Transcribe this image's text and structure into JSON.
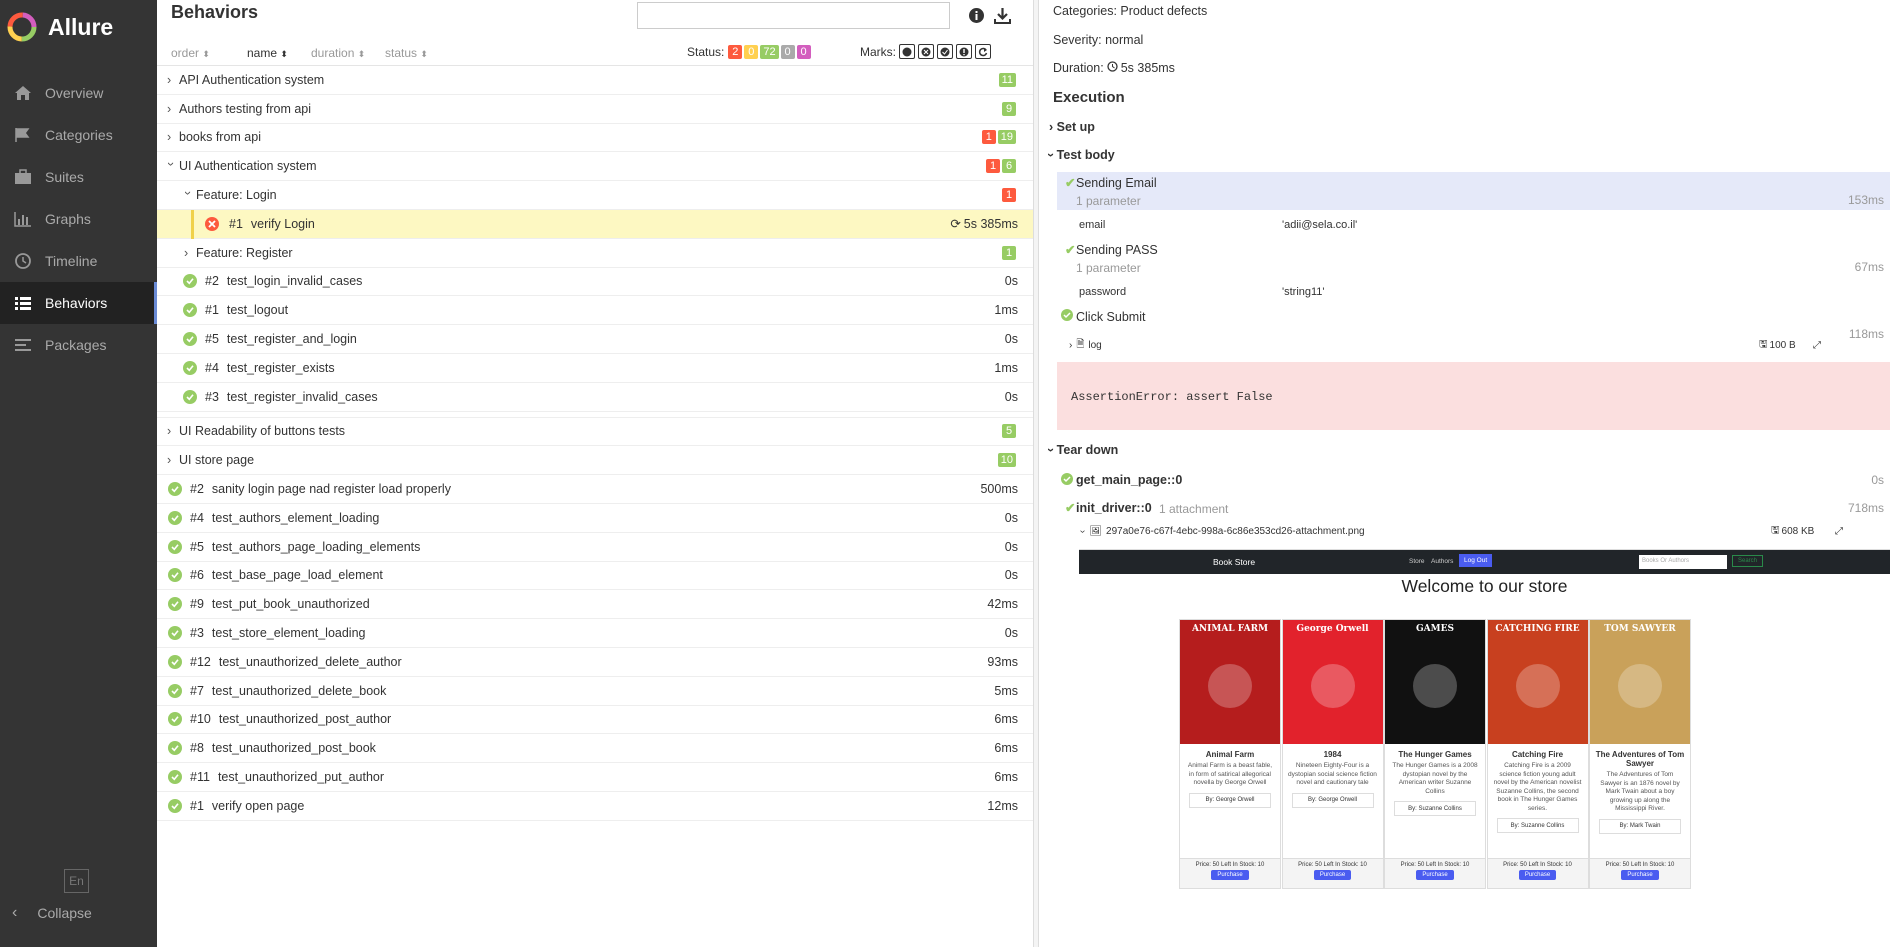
{
  "sidebar": {
    "brand": "Allure",
    "items": [
      {
        "label": "Overview",
        "icon": "home-icon"
      },
      {
        "label": "Categories",
        "icon": "flag-icon"
      },
      {
        "label": "Suites",
        "icon": "briefcase-icon"
      },
      {
        "label": "Graphs",
        "icon": "bar-chart-icon"
      },
      {
        "label": "Timeline",
        "icon": "clock-icon"
      },
      {
        "label": "Behaviors",
        "icon": "list-icon"
      },
      {
        "label": "Packages",
        "icon": "align-left-icon"
      }
    ],
    "active": "Behaviors",
    "lang": "En",
    "collapse": "Collapse"
  },
  "behaviors": {
    "title": "Behaviors",
    "search_placeholder": "",
    "sort": {
      "order": "order",
      "name": "name",
      "duration": "duration",
      "status": "status"
    },
    "status_label": "Status:",
    "status_counts": [
      {
        "value": "2",
        "color": "#fd5a3e"
      },
      {
        "value": "0",
        "color": "#ffd050"
      },
      {
        "value": "72",
        "color": "#97cc64"
      },
      {
        "value": "0",
        "color": "#aaaaaa"
      },
      {
        "value": "0",
        "color": "#d35ebe"
      }
    ],
    "marks_label": "Marks:",
    "groups": [
      {
        "label": "API Authentication system",
        "counts": [
          {
            "v": "11",
            "c": "#97cc64"
          }
        ]
      },
      {
        "label": "Authors testing from api",
        "counts": [
          {
            "v": "9",
            "c": "#97cc64"
          }
        ]
      },
      {
        "label": "books from api",
        "counts": [
          {
            "v": "1",
            "c": "#fd5a3e"
          },
          {
            "v": "19",
            "c": "#97cc64"
          }
        ]
      },
      {
        "label": "UI Authentication system",
        "counts": [
          {
            "v": "1",
            "c": "#fd5a3e"
          },
          {
            "v": "6",
            "c": "#97cc64"
          }
        ]
      }
    ],
    "feature_login": {
      "label": "Feature: Login",
      "count": "1"
    },
    "selected_test": {
      "num": "#1",
      "name": "verify Login",
      "duration": "5s 385ms"
    },
    "feature_register": {
      "label": "Feature: Register",
      "count": "1"
    },
    "auth_tests": [
      {
        "num": "#2",
        "name": "test_login_invalid_cases",
        "dur": "0s"
      },
      {
        "num": "#1",
        "name": "test_logout",
        "dur": "1ms"
      },
      {
        "num": "#5",
        "name": "test_register_and_login",
        "dur": "0s"
      },
      {
        "num": "#4",
        "name": "test_register_exists",
        "dur": "1ms"
      },
      {
        "num": "#3",
        "name": "test_register_invalid_cases",
        "dur": "0s"
      }
    ],
    "groups2": [
      {
        "label": "UI Readability of buttons tests",
        "count": "5"
      },
      {
        "label": "UI store page",
        "count": "10"
      }
    ],
    "root_tests": [
      {
        "num": "#2",
        "name": "sanity login page nad register load properly",
        "dur": "500ms"
      },
      {
        "num": "#4",
        "name": "test_authors_element_loading",
        "dur": "0s"
      },
      {
        "num": "#5",
        "name": "test_authors_page_loading_elements",
        "dur": "0s"
      },
      {
        "num": "#6",
        "name": "test_base_page_load_element",
        "dur": "0s"
      },
      {
        "num": "#9",
        "name": "test_put_book_unauthorized",
        "dur": "42ms"
      },
      {
        "num": "#3",
        "name": "test_store_element_loading",
        "dur": "0s"
      },
      {
        "num": "#12",
        "name": "test_unauthorized_delete_author",
        "dur": "93ms"
      },
      {
        "num": "#7",
        "name": "test_unauthorized_delete_book",
        "dur": "5ms"
      },
      {
        "num": "#10",
        "name": "test_unauthorized_post_author",
        "dur": "6ms"
      },
      {
        "num": "#8",
        "name": "test_unauthorized_post_book",
        "dur": "6ms"
      },
      {
        "num": "#11",
        "name": "test_unauthorized_put_author",
        "dur": "6ms"
      },
      {
        "num": "#1",
        "name": "verify open page",
        "dur": "12ms"
      }
    ]
  },
  "detail": {
    "categories": "Categories: Product defects",
    "severity": "Severity: normal",
    "duration_label": "Duration:",
    "duration": "5s 385ms",
    "execution": "Execution",
    "setup": "Set up",
    "test_body": "Test body",
    "step1": {
      "name": "Sending Email",
      "params": "1 parameter",
      "dur": "153ms",
      "pname": "email",
      "pval": "'adii@sela.co.il'"
    },
    "step2": {
      "name": "Sending PASS",
      "params": "1 parameter",
      "dur": "67ms",
      "pname": "password",
      "pval": "'string11'"
    },
    "step3": {
      "name": "Click Submit",
      "dur": "118ms"
    },
    "log": {
      "name": "log",
      "size": "100 B"
    },
    "error": "AssertionError: assert False",
    "teardown": "Tear down",
    "td1": {
      "name": "get_main_page::0",
      "dur": "0s"
    },
    "td2": {
      "name": "init_driver::0",
      "attach": "1 attachment",
      "dur": "718ms"
    },
    "attachment": {
      "name": "297a0e76-c67f-4ebc-998a-6c86e353cd26-attachment.png",
      "size": "608 KB"
    }
  },
  "screenshot": {
    "brand": "Book Store",
    "nav": [
      "Store",
      "Authors"
    ],
    "logout": "Log Out",
    "search_placeholder": "Books Or Authors",
    "search_btn": "Search",
    "heading": "Welcome to our store",
    "books": [
      {
        "title": "Animal Farm",
        "cover_text": "ANIMAL FARM",
        "desc": "Animal Farm is a beast fable, in form of satirical allegorical novella by George Orwell",
        "by": "By: George Orwell",
        "price": "Price: 50 Left In Stock: 10",
        "color": "#b51d1d"
      },
      {
        "title": "1984",
        "cover_text": "George Orwell",
        "desc": "Nineteen Eighty-Four is a dystopian social science fiction novel and cautionary tale",
        "by": "By: George Orwell",
        "price": "Price: 50 Left In Stock: 10",
        "color": "#e2222c"
      },
      {
        "title": "The Hunger Games",
        "cover_text": "GAMES",
        "desc": "The Hunger Games is a 2008 dystopian novel by the American writer Suzanne Collins",
        "by": "By: Suzanne Collins",
        "price": "Price: 50 Left In Stock: 10",
        "color": "#111111"
      },
      {
        "title": "Catching Fire",
        "cover_text": "CATCHING FIRE",
        "desc": "Catching Fire is a 2009 science fiction young adult novel by the American novelist Suzanne Collins, the second book in The Hunger Games series.",
        "by": "By: Suzanne Collins",
        "price": "Price: 50 Left In Stock: 10",
        "color": "#c8401f"
      },
      {
        "title": "The Adventures of Tom Sawyer",
        "cover_text": "TOM SAWYER",
        "desc": "The Adventures of Tom Sawyer is an 1876 novel by Mark Twain about a boy growing up along the Mississippi River.",
        "by": "By: Mark Twain",
        "price": "Price: 50 Left In Stock: 10",
        "color": "#c9a15a"
      }
    ],
    "purchase": "Purchase"
  }
}
